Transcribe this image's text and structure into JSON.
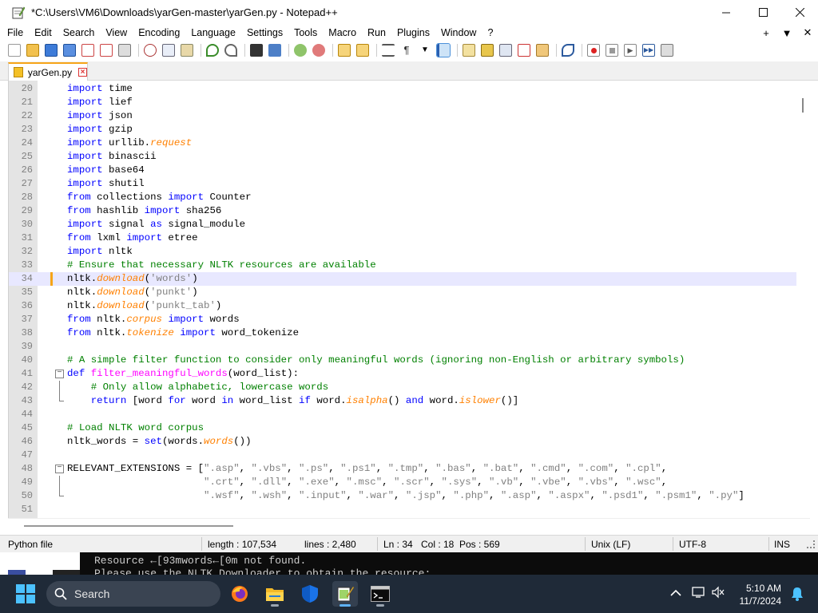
{
  "window": {
    "title": "*C:\\Users\\VM6\\Downloads\\yarGen-master\\yarGen.py - Notepad++",
    "minimize": "—",
    "maximize": "☐",
    "close": "✕"
  },
  "menu": {
    "items": [
      "File",
      "Edit",
      "Search",
      "View",
      "Encoding",
      "Language",
      "Settings",
      "Tools",
      "Macro",
      "Run",
      "Plugins",
      "Window",
      "?"
    ],
    "right": [
      "+",
      "▼",
      "✕"
    ]
  },
  "tab": {
    "label": "yarGen.py"
  },
  "editor": {
    "current_line": 34,
    "lines": [
      {
        "n": "20",
        "code": "import time"
      },
      {
        "n": "21",
        "code": "import lief"
      },
      {
        "n": "22",
        "code": "import json"
      },
      {
        "n": "23",
        "code": "import gzip"
      },
      {
        "n": "24",
        "code": "import urllib.request"
      },
      {
        "n": "25",
        "code": "import binascii"
      },
      {
        "n": "26",
        "code": "import base64"
      },
      {
        "n": "27",
        "code": "import shutil"
      },
      {
        "n": "28",
        "code": "from collections import Counter"
      },
      {
        "n": "29",
        "code": "from hashlib import sha256"
      },
      {
        "n": "30",
        "code": "import signal as signal_module"
      },
      {
        "n": "31",
        "code": "from lxml import etree"
      },
      {
        "n": "32",
        "code": "import nltk"
      },
      {
        "n": "33",
        "code": "# Ensure that necessary NLTK resources are available"
      },
      {
        "n": "34",
        "code": "nltk.download('words')"
      },
      {
        "n": "35",
        "code": "nltk.download('punkt')"
      },
      {
        "n": "36",
        "code": "nltk.download('punkt_tab')"
      },
      {
        "n": "37",
        "code": "from nltk.corpus import words"
      },
      {
        "n": "38",
        "code": "from nltk.tokenize import word_tokenize"
      },
      {
        "n": "39",
        "code": ""
      },
      {
        "n": "40",
        "code": "# A simple filter function to consider only meaningful words (ignoring non-English or arbitrary symbols)"
      },
      {
        "n": "41",
        "code": "def filter_meaningful_words(word_list):"
      },
      {
        "n": "42",
        "code": "    # Only allow alphabetic, lowercase words"
      },
      {
        "n": "43",
        "code": "    return [word for word in word_list if word.isalpha() and word.islower()]"
      },
      {
        "n": "44",
        "code": ""
      },
      {
        "n": "45",
        "code": "# Load NLTK word corpus"
      },
      {
        "n": "46",
        "code": "nltk_words = set(words.words())"
      },
      {
        "n": "47",
        "code": ""
      },
      {
        "n": "48",
        "code": "RELEVANT_EXTENSIONS = [\".asp\", \".vbs\", \".ps\", \".ps1\", \".tmp\", \".bas\", \".bat\", \".cmd\", \".com\", \".cpl\","
      },
      {
        "n": "49",
        "code": "                       \".crt\", \".dll\", \".exe\", \".msc\", \".scr\", \".sys\", \".vb\", \".vbe\", \".vbs\", \".wsc\","
      },
      {
        "n": "50",
        "code": "                       \".wsf\", \".wsh\", \".input\", \".war\", \".jsp\", \".php\", \".asp\", \".aspx\", \".psd1\", \".psm1\", \".py\"]"
      },
      {
        "n": "51",
        "code": ""
      }
    ]
  },
  "status": {
    "file_type": "Python file",
    "length": "length : 107,534",
    "lines": "lines : 2,480",
    "ln": "Ln : 34",
    "col": "Col : 18",
    "pos": "Pos : 569",
    "eol": "Unix (LF)",
    "encoding": "UTF-8",
    "mode": "INS"
  },
  "console": {
    "line1": "Resource ←[93mwords←[0m not found.",
    "line2": "Please use the NLTK Downloader to obtain the resource:"
  },
  "taskbar": {
    "search_label": "Search",
    "time": "5:10 AM",
    "date": "11/7/2024"
  },
  "colors": {
    "keyword": "#0000ff",
    "comment": "#008000",
    "method": "#ff8000",
    "function": "#ff00ff",
    "string": "#808080",
    "taskbar": "#1f2a38",
    "accent": "#f6a418"
  }
}
